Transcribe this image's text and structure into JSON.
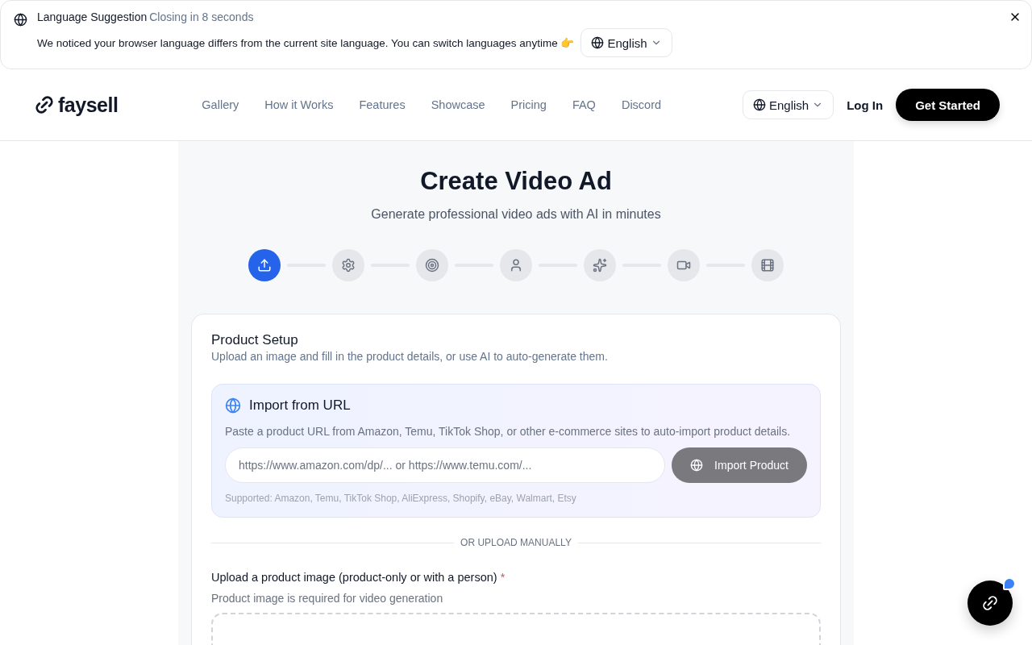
{
  "banner": {
    "title": "Language Suggestion",
    "countdown": "Closing in 8 seconds",
    "message": "We noticed your browser language differs from the current site language. You can switch languages anytime 👉",
    "language": "English"
  },
  "header": {
    "logo": "faysell",
    "nav": [
      "Gallery",
      "How it Works",
      "Features",
      "Showcase",
      "Pricing",
      "FAQ",
      "Discord"
    ],
    "language": "English",
    "login": "Log In",
    "cta": "Get Started"
  },
  "page": {
    "title": "Create Video Ad",
    "subtitle": "Generate professional video ads with AI in minutes"
  },
  "steps": [
    {
      "kind": "upload",
      "selected": true
    },
    {
      "kind": "settings",
      "selected": false
    },
    {
      "kind": "target",
      "selected": false
    },
    {
      "kind": "user",
      "selected": false
    },
    {
      "kind": "sparkles",
      "selected": false
    },
    {
      "kind": "video",
      "selected": false
    },
    {
      "kind": "film",
      "selected": false
    }
  ],
  "card": {
    "title": "Product Setup",
    "description": "Upload an image and fill in the product details, or use AI to auto-generate them.",
    "import": {
      "title": "Import from URL",
      "description": "Paste a product URL from Amazon, Temu, TikTok Shop, or other e-commerce sites to auto-import product details.",
      "placeholder": "https://www.amazon.com/dp/... or https://www.temu.com/...",
      "button": "Import Product",
      "supported": "Supported: Amazon, Temu, TikTok Shop, AliExpress, Shopify, eBay, Walmart, Etsy"
    },
    "divider": "OR UPLOAD MANUALLY",
    "upload": {
      "label": "Upload a product image (product-only or with a person)",
      "required_mark": "*",
      "hint": "Product image is required for video generation"
    }
  }
}
